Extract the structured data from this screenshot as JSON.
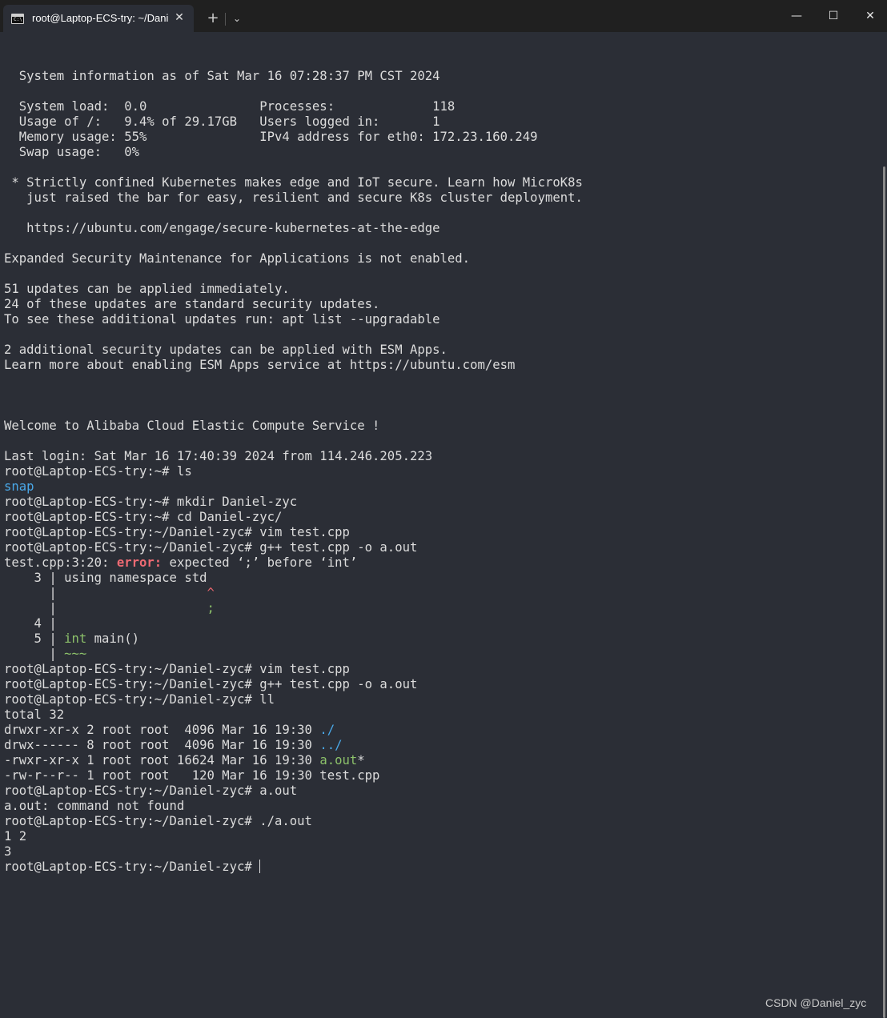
{
  "titlebar": {
    "tab_title": "root@Laptop-ECS-try: ~/Dani",
    "tab_icon_text": "C:\\",
    "close_glyph": "✕",
    "new_tab_glyph": "+",
    "dropdown_glyph": "⌄",
    "minimize_glyph": "—",
    "maximize_glyph": "☐",
    "window_close_glyph": "✕"
  },
  "terminal": {
    "lines": [
      [
        {
          "t": ""
        }
      ],
      [
        {
          "t": "  System information as of Sat Mar 16 07:28:37 PM CST 2024"
        }
      ],
      [
        {
          "t": ""
        }
      ],
      [
        {
          "t": "  System load:  0.0               Processes:             118"
        }
      ],
      [
        {
          "t": "  Usage of /:   9.4% of 29.17GB   Users logged in:       1"
        }
      ],
      [
        {
          "t": "  Memory usage: 55%               IPv4 address for eth0: 172.23.160.249"
        }
      ],
      [
        {
          "t": "  Swap usage:   0%"
        }
      ],
      [
        {
          "t": ""
        }
      ],
      [
        {
          "t": " * Strictly confined Kubernetes makes edge and IoT secure. Learn how MicroK8s"
        }
      ],
      [
        {
          "t": "   just raised the bar for easy, resilient and secure K8s cluster deployment."
        }
      ],
      [
        {
          "t": ""
        }
      ],
      [
        {
          "t": "   https://ubuntu.com/engage/secure-kubernetes-at-the-edge"
        }
      ],
      [
        {
          "t": ""
        }
      ],
      [
        {
          "t": "Expanded Security Maintenance for Applications is not enabled."
        }
      ],
      [
        {
          "t": ""
        }
      ],
      [
        {
          "t": "51 updates can be applied immediately."
        }
      ],
      [
        {
          "t": "24 of these updates are standard security updates."
        }
      ],
      [
        {
          "t": "To see these additional updates run: apt list --upgradable"
        }
      ],
      [
        {
          "t": ""
        }
      ],
      [
        {
          "t": "2 additional security updates can be applied with ESM Apps."
        }
      ],
      [
        {
          "t": "Learn more about enabling ESM Apps service at https://ubuntu.com/esm"
        }
      ],
      [
        {
          "t": ""
        }
      ],
      [
        {
          "t": ""
        }
      ],
      [
        {
          "t": ""
        }
      ],
      [
        {
          "t": "Welcome to Alibaba Cloud Elastic Compute Service !"
        }
      ],
      [
        {
          "t": ""
        }
      ],
      [
        {
          "t": "Last login: Sat Mar 16 17:40:39 2024 from 114.246.205.223"
        }
      ],
      [
        {
          "t": "root@Laptop-ECS-try:~# ls"
        }
      ],
      [
        {
          "t": "snap",
          "c": "blue"
        }
      ],
      [
        {
          "t": "root@Laptop-ECS-try:~# mkdir Daniel-zyc"
        }
      ],
      [
        {
          "t": "root@Laptop-ECS-try:~# cd Daniel-zyc/"
        }
      ],
      [
        {
          "t": "root@Laptop-ECS-try:~/Daniel-zyc# vim test.cpp"
        }
      ],
      [
        {
          "t": "root@Laptop-ECS-try:~/Daniel-zyc# g++ test.cpp -o a.out"
        }
      ],
      [
        {
          "t": "test.cpp:3:20: "
        },
        {
          "t": "error:",
          "c": "bold-red"
        },
        {
          "t": " expected ‘;’ before ‘int’"
        }
      ],
      [
        {
          "t": "    3 | using namespace std"
        }
      ],
      [
        {
          "t": "      |                    "
        },
        {
          "t": "^",
          "c": "red"
        }
      ],
      [
        {
          "t": "      |                    "
        },
        {
          "t": ";",
          "c": "green"
        }
      ],
      [
        {
          "t": "    4 |"
        }
      ],
      [
        {
          "t": "    5 | "
        },
        {
          "t": "int",
          "c": "green"
        },
        {
          "t": " main()"
        }
      ],
      [
        {
          "t": "      | "
        },
        {
          "t": "~~~",
          "c": "green"
        }
      ],
      [
        {
          "t": "root@Laptop-ECS-try:~/Daniel-zyc# vim test.cpp"
        }
      ],
      [
        {
          "t": "root@Laptop-ECS-try:~/Daniel-zyc# g++ test.cpp -o a.out"
        }
      ],
      [
        {
          "t": "root@Laptop-ECS-try:~/Daniel-zyc# ll"
        }
      ],
      [
        {
          "t": "total 32"
        }
      ],
      [
        {
          "t": "drwxr-xr-x 2 root root  4096 Mar 16 19:30 "
        },
        {
          "t": "./",
          "c": "blue"
        }
      ],
      [
        {
          "t": "drwx------ 8 root root  4096 Mar 16 19:30 "
        },
        {
          "t": "../",
          "c": "blue"
        }
      ],
      [
        {
          "t": "-rwxr-xr-x 1 root root 16624 Mar 16 19:30 "
        },
        {
          "t": "a.out",
          "c": "green"
        },
        {
          "t": "*"
        }
      ],
      [
        {
          "t": "-rw-r--r-- 1 root root   120 Mar 16 19:30 test.cpp"
        }
      ],
      [
        {
          "t": "root@Laptop-ECS-try:~/Daniel-zyc# a.out"
        }
      ],
      [
        {
          "t": "a.out: command not found"
        }
      ],
      [
        {
          "t": "root@Laptop-ECS-try:~/Daniel-zyc# ./a.out"
        }
      ],
      [
        {
          "t": "1 2"
        }
      ],
      [
        {
          "t": "3"
        }
      ],
      [
        {
          "t": "root@Laptop-ECS-try:~/Daniel-zyc# "
        },
        {
          "cursor": true
        }
      ]
    ]
  },
  "colors": {
    "background": "#2b2e36",
    "titlebar": "#202020",
    "text": "#dcdcdc",
    "directory_blue": "#4aa8e8",
    "executable_green": "#8cc16a",
    "error_red": "#ee6a73"
  },
  "watermark": "CSDN @Daniel_zyc"
}
